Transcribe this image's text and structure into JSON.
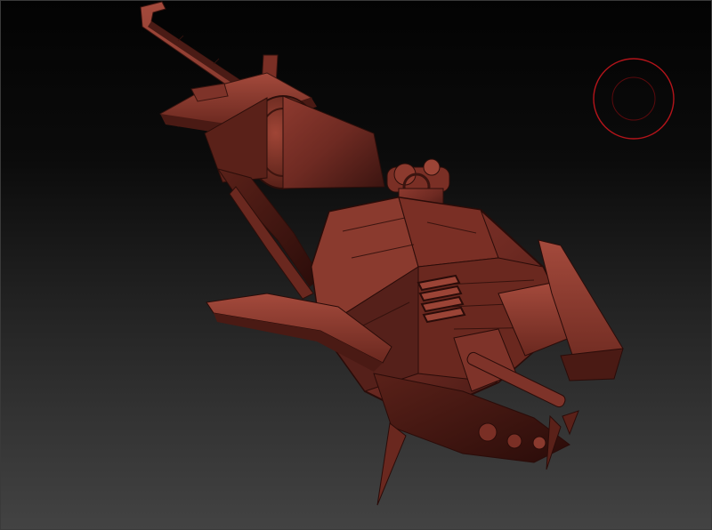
{
  "viewport": {
    "background_top": "#030303",
    "background_bottom": "#434343"
  },
  "model": {
    "material": "red wax",
    "base_color": "#6b2a22",
    "highlight_color": "#9a4538",
    "shadow_color": "#2c0e0a"
  },
  "brush_cursor": {
    "stroke_color": "#b3141a"
  }
}
